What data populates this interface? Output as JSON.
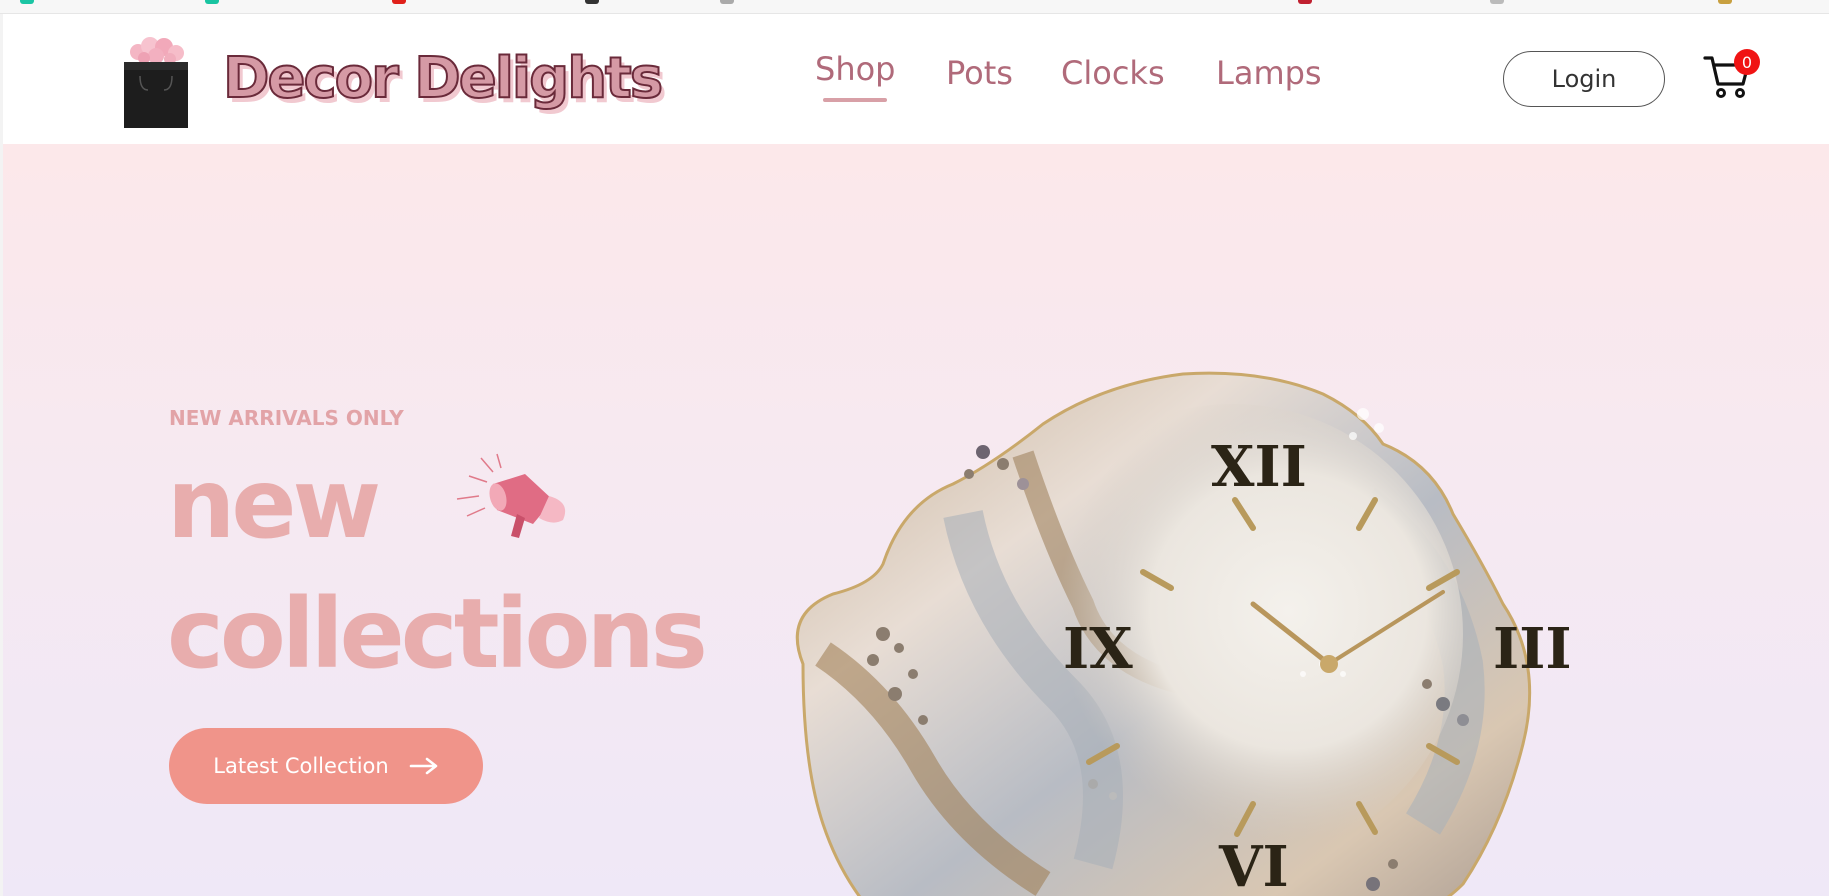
{
  "header": {
    "brand": "Decor Delights",
    "logo_icon": "shopping-bag-with-roses-icon",
    "nav": [
      {
        "label": "Shop",
        "active": true
      },
      {
        "label": "Pots",
        "active": false
      },
      {
        "label": "Clocks",
        "active": false
      },
      {
        "label": "Lamps",
        "active": false
      }
    ],
    "login_label": "Login",
    "cart_icon": "cart-icon",
    "cart_count": "0"
  },
  "hero": {
    "eyebrow": "NEW ARRIVALS ONLY",
    "headline_line1": "new",
    "headline_line2": "collections",
    "megaphone_icon": "megaphone-icon",
    "cta_label": "Latest Collection",
    "cta_icon": "arrow-right-icon",
    "image": "resin-wall-clock-image",
    "clock_numerals": [
      "XII",
      "III",
      "VI",
      "IX"
    ]
  },
  "colors": {
    "brand_fill": "#d59aa5",
    "brand_outline": "#6a2a3a",
    "nav_text": "#b06a7a",
    "headline": "#e8adad",
    "cta_bg": "#f0948a",
    "badge": "#f01414",
    "hero_top": "#fce8ea",
    "hero_bottom": "#efe8f7"
  }
}
